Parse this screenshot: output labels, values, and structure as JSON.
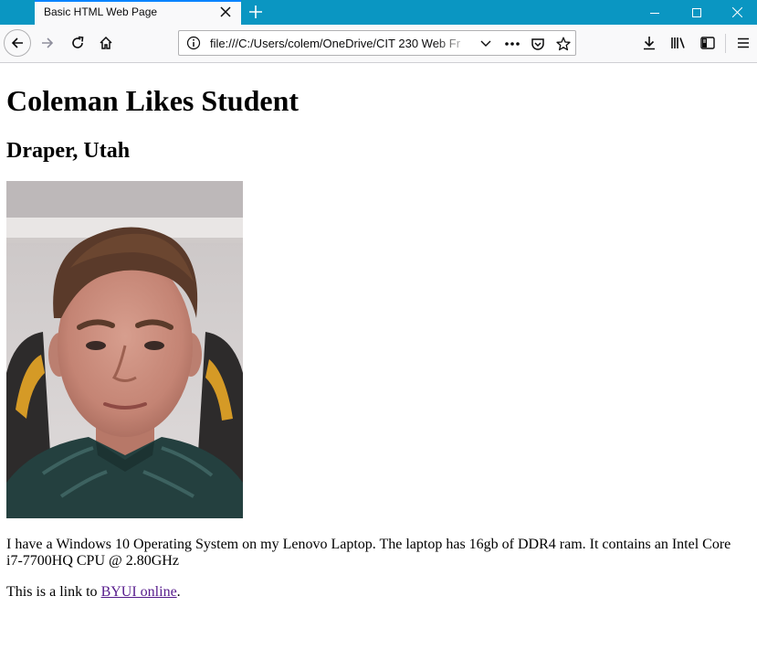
{
  "browser": {
    "tab": {
      "title": "Basic HTML Web Page"
    },
    "url": "file:///C:/Users/colem/OneDrive/CIT 230 Web Fr",
    "accent_color": "#0a96c2"
  },
  "page": {
    "heading": "Coleman Likes Student",
    "subheading": "Draper, Utah",
    "paragraph1": "I have a Windows 10 Operating System on my Lenovo Laptop. The laptop has 16gb of DDR4 ram. It contains an Intel Core i7-7700HQ CPU @ 2.80GHz",
    "link_prefix": "This is a link to ",
    "link_text": "BYUI online",
    "link_suffix": ".",
    "link_color": "#551a8b"
  },
  "icons": {
    "tab_close": "close-icon",
    "new_tab": "plus-icon",
    "back": "arrow-left-icon",
    "forward": "arrow-right-icon",
    "reload": "reload-icon",
    "home": "home-icon",
    "info": "info-icon",
    "dropdown": "chevron-down-icon",
    "more": "more-dots-icon",
    "pocket": "pocket-icon",
    "bookmark": "star-icon",
    "downloads": "download-icon",
    "library": "library-icon",
    "sidebar": "sidebar-icon",
    "menu": "hamburger-menu-icon",
    "minimize": "minimize-icon",
    "maximize": "maximize-icon",
    "close_window": "close-window-icon"
  }
}
